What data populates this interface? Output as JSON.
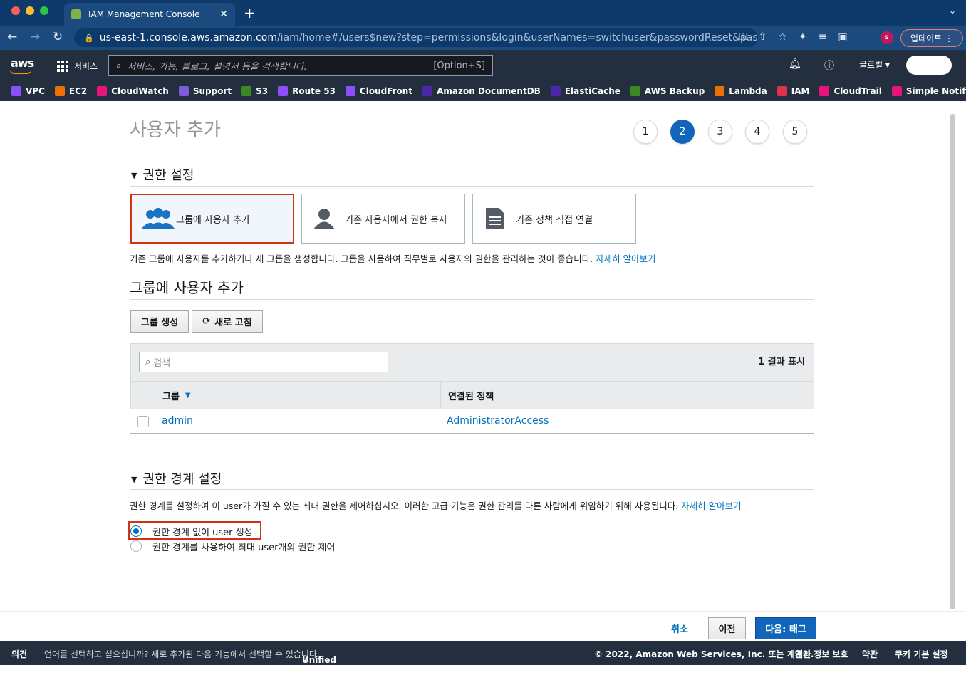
{
  "browser": {
    "tab_title": "IAM Management Console",
    "url_host": "us-east-1.console.aws.amazon.com",
    "url_path": "/iam/home#/users$new?step=permissions&login&userNames=switchuser&passwordReset&pass...",
    "update_label": "업데이트",
    "profile_initial": "s"
  },
  "aws_nav": {
    "logo": "aws",
    "services": "서비스",
    "search_placeholder": "서비스, 기능, 블로그, 설명서 등을 검색합니다.",
    "search_hint": "[Option+S]",
    "region": "글로벌 ▾"
  },
  "bookmarks": [
    {
      "label": "VPC",
      "color": "#8c4fff"
    },
    {
      "label": "EC2",
      "color": "#ed7100"
    },
    {
      "label": "CloudWatch",
      "color": "#e7157b"
    },
    {
      "label": "Support",
      "color": "#7b5cd6"
    },
    {
      "label": "S3",
      "color": "#3f8624"
    },
    {
      "label": "Route 53",
      "color": "#8c4fff"
    },
    {
      "label": "CloudFront",
      "color": "#8c4fff"
    },
    {
      "label": "Amazon DocumentDB",
      "color": "#4d27aa"
    },
    {
      "label": "ElastiCache",
      "color": "#4d27aa"
    },
    {
      "label": "AWS Backup",
      "color": "#3f8624"
    },
    {
      "label": "Lambda",
      "color": "#ed7100"
    },
    {
      "label": "IAM",
      "color": "#dd344c"
    },
    {
      "label": "CloudTrail",
      "color": "#e7157b"
    },
    {
      "label": "Simple Notification Ser",
      "color": "#e7157b"
    }
  ],
  "page": {
    "title": "사용자 추가",
    "steps": [
      "1",
      "2",
      "3",
      "4",
      "5"
    ],
    "active_step": "2",
    "perm_section": "권한 설정",
    "options": [
      "그룹에 사용자 추가",
      "기존 사용자에서 권한 복사",
      "기존 정책 직접 연결"
    ],
    "perm_desc": "기존 그룹에 사용자를 추가하거나 새 그룹을 생성합니다. 그룹을 사용하여 직무별로 사용자의 권한을 관리하는 것이 좋습니다.",
    "learn_more": "자세히 알아보기",
    "group_heading": "그룹에 사용자 추가",
    "create_group": "그룹 생성",
    "refresh": "새로 고침",
    "table_search_placeholder": "검색",
    "result_count": "1 결과 표시",
    "col_group": "그룹",
    "col_policy": "연결된 정책",
    "rows": [
      {
        "group": "admin",
        "policy": "AdministratorAccess"
      }
    ],
    "boundary_section": "권한 경계 설정",
    "boundary_desc": "권한 경계를 설정하여 이 user가 가질 수 있는 최대 권한을 제어하십시오. 이러한 고급 기능은 권한 관리를 다른 사람에게 위임하기 위해 사용됩니다.",
    "radio1": "권한 경계 없이 user 생성",
    "radio2": "권한 경계를 사용하여 최대 user개의 권한 제어"
  },
  "actions": {
    "cancel": "취소",
    "previous": "이전",
    "next": "다음: 태그"
  },
  "footer": {
    "feedback": "의견",
    "lang_msg": "언어를 선택하고 싶으십니까? 새로 추가된 다음 기능에서 선택할 수 있습니다.",
    "unified": "Unified Settings",
    "copyright": "© 2022, Amazon Web Services, Inc. 또는 계열사.",
    "privacy": "개인 정보 보호",
    "terms": "약관",
    "cookies": "쿠키 기본 설정"
  }
}
